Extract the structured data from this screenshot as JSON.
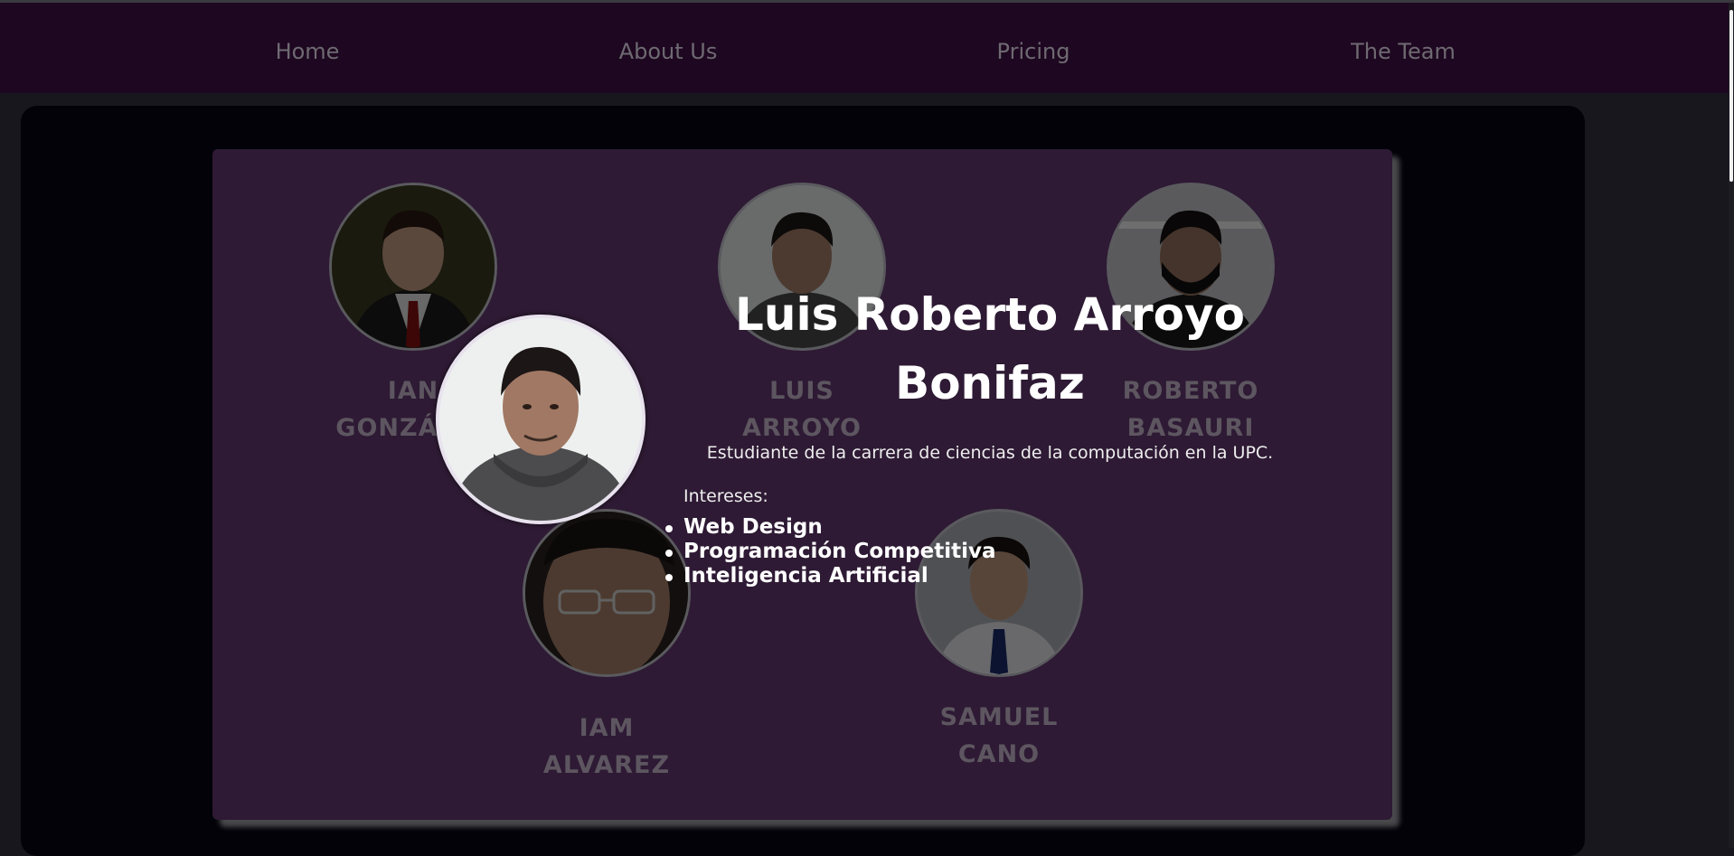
{
  "nav": {
    "items": [
      {
        "label": "Home"
      },
      {
        "label": "About Us"
      },
      {
        "label": "Pricing"
      },
      {
        "label": "The Team"
      }
    ]
  },
  "team": {
    "members": [
      {
        "name_line1": "IAN",
        "name_line2": "GONZÁLEZ",
        "photo": "portrait-suit-red-tie"
      },
      {
        "name_line1": "LUIS",
        "name_line2": "ARROYO",
        "photo": "portrait-hoodie"
      },
      {
        "name_line1": "ROBERTO",
        "name_line2": "BASAURI",
        "photo": "portrait-mask"
      },
      {
        "name_line1": "IAM",
        "name_line2": "ALVAREZ",
        "photo": "portrait-glasses-closeup"
      },
      {
        "name_line1": "SAMUEL",
        "name_line2": "CANO",
        "photo": "portrait-shirt-blue-tie"
      }
    ]
  },
  "detail": {
    "title": "Luis Roberto Arroyo Bonifaz",
    "description": "Estudiante de la carrera de ciencias de la computación en la UPC.",
    "interests_label": "Intereses:",
    "interests": [
      "Web Design",
      "Programación Competitiva",
      "Inteligencia Artificial"
    ]
  },
  "colors": {
    "navbar_bg": "#1e0720",
    "card_bg": "#2e1a34",
    "panel_bg": "#020208",
    "page_bg": "#17171d"
  }
}
